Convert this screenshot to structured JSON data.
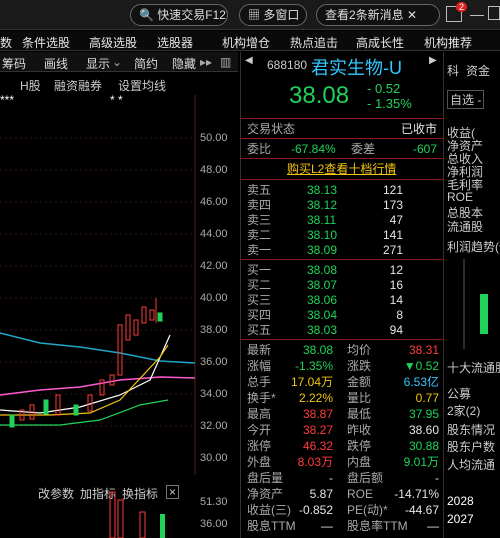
{
  "topbar": {
    "fast_trade": "快速交易F12",
    "multi_window": "多窗口",
    "messages": "查看2条新消息",
    "msg_count": "2"
  },
  "menu": [
    "数",
    "条件选股",
    "高级选股",
    "选股器",
    "机构增仓",
    "热点追击",
    "高成长性",
    "机构推荐"
  ],
  "toolbar": {
    "code": "筹码",
    "draw": "画线",
    "display": "显示",
    "simple": "简约",
    "hide": "隐藏"
  },
  "subbar": {
    "h": "H股",
    "margin": "融资融券",
    "settings": "设置均线",
    "stars": "***",
    "stars2": "* *"
  },
  "y_labels": [
    "50.00",
    "48.00",
    "46.00",
    "44.00",
    "42.00",
    "40.00",
    "38.00",
    "36.00",
    "34.00",
    "32.00",
    "30.00"
  ],
  "indicator_bar": {
    "restore": "改参数",
    "add": "加指标",
    "switch": "换指标",
    "close": "×",
    "y_top": "51.30",
    "y_next": "36.00"
  },
  "quote": {
    "code": "688180",
    "name": "君实生物-U",
    "price": "38.08",
    "change": "- 0.52",
    "change_pct": "- 1.35%",
    "status_label": "交易状态",
    "status_value": "已收市",
    "wb_label": "委比",
    "wb_value": "-67.84%",
    "wc_label": "委差",
    "wc_value": "-607",
    "l2_link": "购买L2查看十档行情",
    "asks": [
      {
        "label": "卖五",
        "price": "38.13",
        "vol": "121"
      },
      {
        "label": "卖四",
        "price": "38.12",
        "vol": "173"
      },
      {
        "label": "卖三",
        "price": "38.11",
        "vol": "47"
      },
      {
        "label": "卖二",
        "price": "38.10",
        "vol": "141"
      },
      {
        "label": "卖一",
        "price": "38.09",
        "vol": "271"
      }
    ],
    "bids": [
      {
        "label": "买一",
        "price": "38.08",
        "vol": "12"
      },
      {
        "label": "买二",
        "price": "38.07",
        "vol": "16"
      },
      {
        "label": "买三",
        "price": "38.06",
        "vol": "14"
      },
      {
        "label": "买四",
        "price": "38.04",
        "vol": "8"
      },
      {
        "label": "买五",
        "price": "38.03",
        "vol": "94"
      }
    ],
    "stats": [
      {
        "l": "最新",
        "v": "38.08",
        "vc": "green",
        "l2": "均价",
        "v2": "38.31",
        "v2c": "red"
      },
      {
        "l": "涨幅",
        "v": "-1.35%",
        "vc": "green",
        "l2": "涨跌",
        "v2": "▼0.52",
        "v2c": "green"
      },
      {
        "l": "总手",
        "v": "17.04万",
        "vc": "yel",
        "l2": "金额",
        "v2": "6.53亿",
        "v2c": "cy"
      },
      {
        "l": "换手*",
        "v": "2.22%",
        "vc": "yel",
        "l2": "量比",
        "v2": "0.77",
        "v2c": "yel"
      },
      {
        "l": "最高",
        "v": "38.87",
        "vc": "red",
        "l2": "最低",
        "v2": "37.95",
        "v2c": "green"
      },
      {
        "l": "今开",
        "v": "38.27",
        "vc": "red",
        "l2": "昨收",
        "v2": "38.60",
        "v2c": "wh"
      },
      {
        "l": "涨停",
        "v": "46.32",
        "vc": "red",
        "l2": "跌停",
        "v2": "30.88",
        "v2c": "green"
      },
      {
        "l": "外盘",
        "v": "8.03万",
        "vc": "red",
        "l2": "内盘",
        "v2": "9.01万",
        "v2c": "green"
      },
      {
        "l": "盘后量",
        "v": "-",
        "vc": "wh",
        "l2": "盘后额",
        "v2": "-",
        "v2c": "wh"
      },
      {
        "l": "净资产",
        "v": "5.87",
        "vc": "wh",
        "l2": "ROE",
        "v2": "-14.71%",
        "v2c": "wh"
      },
      {
        "l": "收益(三)",
        "v": "-0.852",
        "vc": "wh",
        "l2": "PE(动)*",
        "v2": "-44.67",
        "v2c": "wh"
      },
      {
        "l": "股息TTM",
        "v": "—",
        "vc": "wh",
        "l2": "股息率TTM",
        "v2": "—",
        "v2c": "wh"
      }
    ]
  },
  "far": {
    "tabs": [
      "科",
      "资金"
    ],
    "select": "自选 -",
    "items": [
      "收益(",
      "净资产",
      "总收入",
      "净利润",
      "毛利率",
      "ROE",
      "总股本",
      "流通股"
    ],
    "trend": "利润趋势(亿",
    "holders": "十大流通股",
    "h1": "公募",
    "h2": "2家(2)",
    "h3": "股东情况",
    "h4": "股东户数",
    "h5": "人均流通",
    "years": [
      "2028",
      "2027"
    ]
  }
}
